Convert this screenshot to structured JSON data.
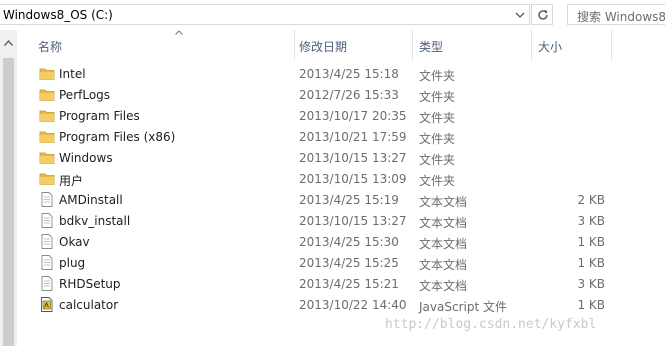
{
  "toolbar": {
    "address": "Windows8_OS (C:)",
    "search_placeholder": "搜索 Windows8"
  },
  "columns": {
    "name": "名称",
    "date": "修改日期",
    "type": "类型",
    "size": "大小"
  },
  "files": [
    {
      "name": "Intel",
      "date": "2013/4/25 15:18",
      "type": "文件夹",
      "size": "",
      "icon": "folder-icon"
    },
    {
      "name": "PerfLogs",
      "date": "2012/7/26 15:33",
      "type": "文件夹",
      "size": "",
      "icon": "folder-icon"
    },
    {
      "name": "Program Files",
      "date": "2013/10/17 20:35",
      "type": "文件夹",
      "size": "",
      "icon": "folder-icon"
    },
    {
      "name": "Program Files (x86)",
      "date": "2013/10/21 17:59",
      "type": "文件夹",
      "size": "",
      "icon": "folder-icon"
    },
    {
      "name": "Windows",
      "date": "2013/10/15 13:27",
      "type": "文件夹",
      "size": "",
      "icon": "folder-icon"
    },
    {
      "name": "用户",
      "date": "2013/10/15 13:09",
      "type": "文件夹",
      "size": "",
      "icon": "folder-icon"
    },
    {
      "name": "AMDinstall",
      "date": "2013/4/25 15:19",
      "type": "文本文档",
      "size": "2 KB",
      "icon": "text-file-icon"
    },
    {
      "name": "bdkv_install",
      "date": "2013/10/15 13:27",
      "type": "文本文档",
      "size": "3 KB",
      "icon": "text-file-icon"
    },
    {
      "name": "Okav",
      "date": "2013/4/25 15:30",
      "type": "文本文档",
      "size": "1 KB",
      "icon": "text-file-icon"
    },
    {
      "name": "plug",
      "date": "2013/4/25 15:25",
      "type": "文本文档",
      "size": "1 KB",
      "icon": "text-file-icon"
    },
    {
      "name": "RHDSetup",
      "date": "2013/4/25 15:21",
      "type": "文本文档",
      "size": "3 KB",
      "icon": "text-file-icon"
    },
    {
      "name": "calculator",
      "date": "2013/10/22 14:40",
      "type": "JavaScript 文件",
      "size": "1 KB",
      "icon": "script-file-icon"
    }
  ],
  "watermark": "http://blog.csdn.net/kyfxbl",
  "colors": {
    "folder": "#e8b84a",
    "header_text": "#4c607a",
    "secondary_text": "#6d6d6d"
  }
}
